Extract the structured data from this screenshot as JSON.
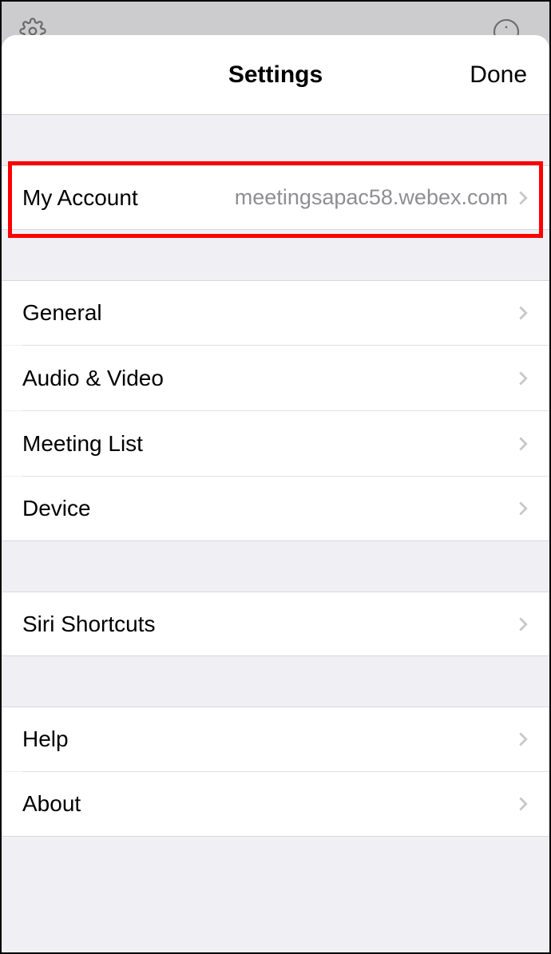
{
  "nav": {
    "title": "Settings",
    "done": "Done"
  },
  "sections": {
    "account": {
      "my_account_label": "My Account",
      "my_account_detail": "meetingsapac58.webex.com"
    },
    "main": {
      "general": "General",
      "audio_video": "Audio & Video",
      "meeting_list": "Meeting List",
      "device": "Device"
    },
    "siri": {
      "siri_shortcuts": "Siri Shortcuts"
    },
    "info": {
      "help": "Help",
      "about": "About"
    }
  }
}
